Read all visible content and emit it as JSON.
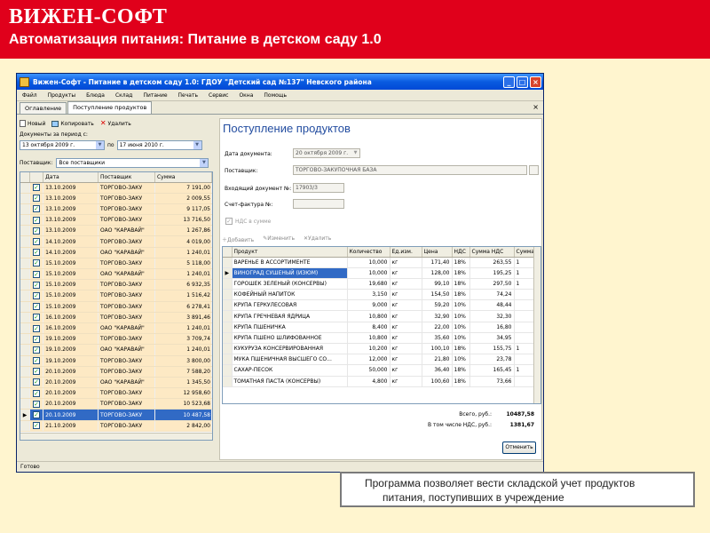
{
  "slide": {
    "brand": "ВИЖЕН-СОФТ",
    "subtitle": "Автоматизация питания: Питание в детском саду 1.0",
    "caption_line1": "Программа позволяет вести складской учет продуктов",
    "caption_line2": "питания, поступивших в учреждение",
    "colors": {
      "header_bg": "#e0001b",
      "page_bg": "#fff5cf",
      "caption_border": "#7a7a7a"
    }
  },
  "window": {
    "title": "Вижен-Софт - Питание в детском саду 1.0: ГДОУ \"Детский сад №137\" Невского района",
    "menu": [
      "Файл",
      "Продукты",
      "Блюда",
      "Склад",
      "Питание",
      "Печать",
      "Сервис",
      "Окна",
      "Помощь"
    ],
    "tabs": [
      "Оглавление",
      "Поступление продуктов"
    ],
    "status": "Готово"
  },
  "list": {
    "toolbar": {
      "new": "Новый",
      "copy": "Копировать",
      "delete": "Удалить"
    },
    "period_label": "Документы за период с:",
    "date_from": "13 октября 2009 г.",
    "po_label": "по",
    "date_to_day": "17",
    "date_to_month": "июня",
    "date_to_year": "2010 г.",
    "supplier_label": "Поставщик:",
    "supplier_value": "Все поставщики",
    "columns": [
      "Дата",
      "Поставщик",
      "Сумма"
    ],
    "rows": [
      {
        "date": "13.10.2009",
        "supplier": "ТОРГОВО-ЗАКУ",
        "sum": "7 191,00"
      },
      {
        "date": "13.10.2009",
        "supplier": "ТОРГОВО-ЗАКУ",
        "sum": "2 009,55"
      },
      {
        "date": "13.10.2009",
        "supplier": "ТОРГОВО-ЗАКУ",
        "sum": "9 117,05"
      },
      {
        "date": "13.10.2009",
        "supplier": "ТОРГОВО-ЗАКУ",
        "sum": "13 716,50"
      },
      {
        "date": "13.10.2009",
        "supplier": "ОАО \"КАРАВАЙ\"",
        "sum": "1 267,86"
      },
      {
        "date": "14.10.2009",
        "supplier": "ТОРГОВО-ЗАКУ",
        "sum": "4 019,00"
      },
      {
        "date": "14.10.2009",
        "supplier": "ОАО \"КАРАВАЙ\"",
        "sum": "1 240,01"
      },
      {
        "date": "15.10.2009",
        "supplier": "ТОРГОВО-ЗАКУ",
        "sum": "5 118,00"
      },
      {
        "date": "15.10.2009",
        "supplier": "ОАО \"КАРАВАЙ\"",
        "sum": "1 240,01"
      },
      {
        "date": "15.10.2009",
        "supplier": "ТОРГОВО-ЗАКУ",
        "sum": "6 932,35"
      },
      {
        "date": "15.10.2009",
        "supplier": "ТОРГОВО-ЗАКУ",
        "sum": "1 516,42"
      },
      {
        "date": "15.10.2009",
        "supplier": "ТОРГОВО-ЗАКУ",
        "sum": "6 278,41"
      },
      {
        "date": "16.10.2009",
        "supplier": "ТОРГОВО-ЗАКУ",
        "sum": "3 891,46"
      },
      {
        "date": "16.10.2009",
        "supplier": "ОАО \"КАРАВАЙ\"",
        "sum": "1 240,01"
      },
      {
        "date": "19.10.2009",
        "supplier": "ТОРГОВО-ЗАКУ",
        "sum": "3 709,74"
      },
      {
        "date": "19.10.2009",
        "supplier": "ОАО \"КАРАВАЙ\"",
        "sum": "1 240,01"
      },
      {
        "date": "19.10.2009",
        "supplier": "ТОРГОВО-ЗАКУ",
        "sum": "3 800,00"
      },
      {
        "date": "20.10.2009",
        "supplier": "ТОРГОВО-ЗАКУ",
        "sum": "7 588,20"
      },
      {
        "date": "20.10.2009",
        "supplier": "ОАО \"КАРАВАЙ\"",
        "sum": "1 345,50"
      },
      {
        "date": "20.10.2009",
        "supplier": "ТОРГОВО-ЗАКУ",
        "sum": "12 958,60"
      },
      {
        "date": "20.10.2009",
        "supplier": "ТОРГОВО-ЗАКУ",
        "sum": "10 523,68"
      },
      {
        "date": "20.10.2009",
        "supplier": "ТОРГОВО-ЗАКУ",
        "sum": "10 487,58"
      },
      {
        "date": "21.10.2009",
        "supplier": "ТОРГОВО-ЗАКУ",
        "sum": "2 842,00"
      }
    ],
    "selected_index": 21
  },
  "doc": {
    "title": "Поступление продуктов",
    "date_label": "Дата документа:",
    "date_value": "20 октября 2009 г.",
    "supplier_label": "Поставщик:",
    "supplier_value": "ТОРГОВО-ЗАКУПОЧНАЯ БАЗА",
    "incoming_label": "Входящий документ №:",
    "incoming_value": "17903/3",
    "invoice_label": "Счет-фактура №:",
    "vat_label": "НДС в сумме",
    "toolbar": {
      "add": "Добавить",
      "edit": "Изменить",
      "delete": "Удалить"
    },
    "columns": [
      "Продукт",
      "Количество",
      "Ед.изм.",
      "Цена",
      "НДС",
      "Сумма НДС",
      "Сумма"
    ],
    "items": [
      {
        "name": "ВАРЕНЬЕ В АССОРТИМЕНТЕ",
        "qty": "10,000",
        "unit": "кг",
        "price": "171,40",
        "vat": "18%",
        "vat_sum": "263,55",
        "sum": "1"
      },
      {
        "name": "ВИНОГРАД СУШЕНЫЙ (ИЗЮМ)",
        "qty": "10,000",
        "unit": "кг",
        "price": "128,00",
        "vat": "18%",
        "vat_sum": "195,25",
        "sum": "1"
      },
      {
        "name": "ГОРОШЕК ЗЕЛЕНЫЙ (КОНСЕРВЫ)",
        "qty": "19,680",
        "unit": "кг",
        "price": "99,10",
        "vat": "18%",
        "vat_sum": "297,50",
        "sum": "1"
      },
      {
        "name": "КОФЕЙНЫЙ НАПИТОК",
        "qty": "3,150",
        "unit": "кг",
        "price": "154,50",
        "vat": "18%",
        "vat_sum": "74,24",
        "sum": ""
      },
      {
        "name": "КРУПА ГЕРКУЛЕСОВАЯ",
        "qty": "9,000",
        "unit": "кг",
        "price": "59,20",
        "vat": "10%",
        "vat_sum": "48,44",
        "sum": ""
      },
      {
        "name": "КРУПА ГРЕЧНЕВАЯ ЯДРИЦА",
        "qty": "10,800",
        "unit": "кг",
        "price": "32,90",
        "vat": "10%",
        "vat_sum": "32,30",
        "sum": ""
      },
      {
        "name": "КРУПА ПШЕНИЧКА",
        "qty": "8,400",
        "unit": "кг",
        "price": "22,00",
        "vat": "10%",
        "vat_sum": "16,80",
        "sum": ""
      },
      {
        "name": "КРУПА ПШЕНО ШЛИФОВАННОЕ",
        "qty": "10,800",
        "unit": "кг",
        "price": "35,60",
        "vat": "10%",
        "vat_sum": "34,95",
        "sum": ""
      },
      {
        "name": "КУКУРУЗА КОНСЕРВИРОВАННАЯ",
        "qty": "10,200",
        "unit": "кг",
        "price": "100,10",
        "vat": "18%",
        "vat_sum": "155,75",
        "sum": "1"
      },
      {
        "name": "МУКА ПШЕНИЧНАЯ ВЫСШЕГО СО...",
        "qty": "12,000",
        "unit": "кг",
        "price": "21,80",
        "vat": "10%",
        "vat_sum": "23,78",
        "sum": ""
      },
      {
        "name": "САХАР-ПЕСОК",
        "qty": "50,000",
        "unit": "кг",
        "price": "36,40",
        "vat": "18%",
        "vat_sum": "165,45",
        "sum": "1"
      },
      {
        "name": "ТОМАТНАЯ ПАСТА (КОНСЕРВЫ)",
        "qty": "4,800",
        "unit": "кг",
        "price": "100,60",
        "vat": "18%",
        "vat_sum": "73,66",
        "sum": ""
      }
    ],
    "selected_index": 1,
    "total_label": "Всего, руб.:",
    "total_value": "10487,58",
    "vat_total_label": "В том числе НДС, руб.:",
    "vat_total_value": "1381,67",
    "close_label": "Отменить"
  }
}
